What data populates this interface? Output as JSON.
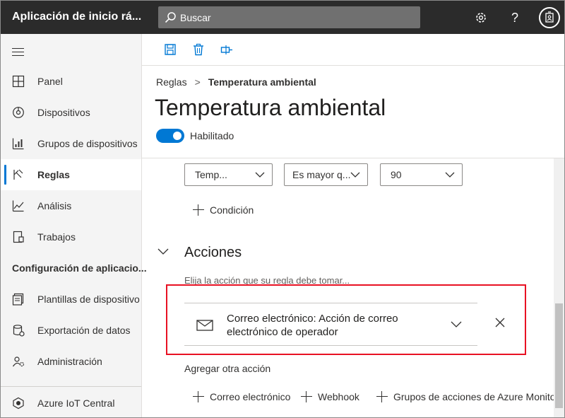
{
  "header": {
    "app_title": "Aplicación de inicio rá...",
    "search_placeholder": "Buscar",
    "help_label": "?"
  },
  "sidebar": {
    "items": [
      {
        "label": "Panel",
        "icon": "dashboard-icon"
      },
      {
        "label": "Dispositivos",
        "icon": "devices-icon"
      },
      {
        "label": "Grupos de dispositivos",
        "icon": "device-groups-icon"
      },
      {
        "label": "Reglas",
        "icon": "rules-icon",
        "active": true
      },
      {
        "label": "Análisis",
        "icon": "analytics-icon"
      },
      {
        "label": "Trabajos",
        "icon": "jobs-icon"
      }
    ],
    "config_section": "Configuración de aplicacio...",
    "config_items": [
      {
        "label": "Plantillas de dispositivo",
        "icon": "device-templates-icon"
      },
      {
        "label": "Exportación de datos",
        "icon": "data-export-icon"
      },
      {
        "label": "Administración",
        "icon": "administration-icon"
      }
    ],
    "footer_item": {
      "label": "Azure IoT Central",
      "icon": "azure-iot-central-icon"
    }
  },
  "toolbar": {
    "buttons": [
      "save-icon",
      "delete-icon",
      "test-action-icon"
    ]
  },
  "breadcrumb": {
    "parent": "Reglas",
    "separator": ">",
    "current": "Temperatura ambiental"
  },
  "page": {
    "title": "Temperatura ambiental",
    "toggle_label": "Habilitado",
    "toggle_on": true
  },
  "condition": {
    "telemetry": "Temp...",
    "operator": "Es mayor q...",
    "value": "90",
    "add_condition": "Condición"
  },
  "actions": {
    "title": "Acciones",
    "hint": "Elija la acción que su regla debe tomar...",
    "card_text": "Correo electrónico: Acción de correo electrónico de operador",
    "add_other": "Agregar otra acción",
    "add_buttons": [
      "Correo electrónico",
      "Webhook",
      "Grupos de acciones de Azure Monitor"
    ]
  },
  "colors": {
    "header_bg": "#2b2b2b",
    "accent": "#0078d4",
    "highlight": "#e81123"
  }
}
